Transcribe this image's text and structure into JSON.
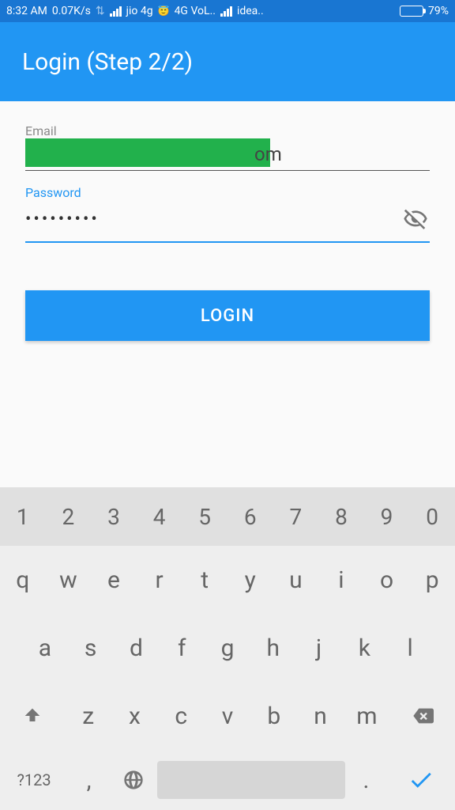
{
  "status": {
    "time": "8:32 AM",
    "speed": "0.07K/s",
    "carrier1": "jio 4g",
    "net1": "4G VoL..",
    "carrier2": "idea..",
    "battery": "79%"
  },
  "header": {
    "title": "Login (Step 2/2)"
  },
  "form": {
    "email_label": "Email",
    "email_visible_fragment": "om",
    "password_label": "Password",
    "password_masked": "•••••••••",
    "login_button": "LOGIN"
  },
  "keyboard": {
    "numbers": [
      "1",
      "2",
      "3",
      "4",
      "5",
      "6",
      "7",
      "8",
      "9",
      "0"
    ],
    "row1": [
      "q",
      "w",
      "e",
      "r",
      "t",
      "y",
      "u",
      "i",
      "o",
      "p"
    ],
    "row2": [
      "a",
      "s",
      "d",
      "f",
      "g",
      "h",
      "j",
      "k",
      "l"
    ],
    "row3": [
      "z",
      "x",
      "c",
      "v",
      "b",
      "n",
      "m"
    ],
    "symbol_key": "?123",
    "comma": ",",
    "period": "."
  }
}
